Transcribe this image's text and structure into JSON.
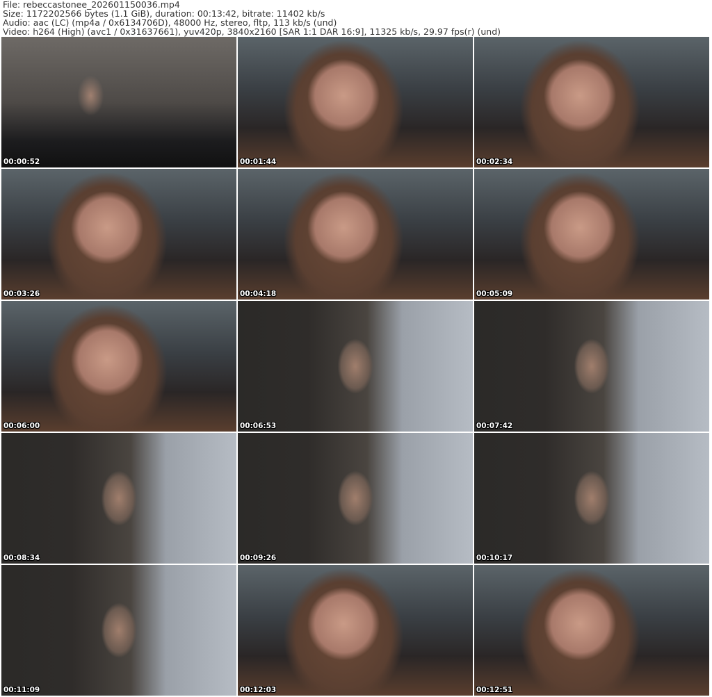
{
  "header": {
    "file": "File: rebeccastonee_202601150036.mp4",
    "size": "Size: 1172202566 bytes (1.1 GiB), duration: 00:13:42, bitrate: 11402 kb/s",
    "audio": "Audio: aac (LC) (mp4a / 0x6134706D), 48000 Hz, stereo, fltp, 113 kb/s (und)",
    "video": "Video: h264 (High) (avc1 / 0x31637661), yuv420p, 3840x2160 [SAR 1:1 DAR 16:9], 11325 kb/s, 29.97 fps(r) (und)"
  },
  "thumbnails": [
    {
      "time": "00:00:52",
      "scene": "first"
    },
    {
      "time": "00:01:44",
      "scene": "close"
    },
    {
      "time": "00:02:34",
      "scene": "close"
    },
    {
      "time": "00:03:26",
      "scene": "close"
    },
    {
      "time": "00:04:18",
      "scene": "close"
    },
    {
      "time": "00:05:09",
      "scene": "close"
    },
    {
      "time": "00:06:00",
      "scene": "close"
    },
    {
      "time": "00:06:53",
      "scene": "wide"
    },
    {
      "time": "00:07:42",
      "scene": "wide"
    },
    {
      "time": "00:08:34",
      "scene": "wide"
    },
    {
      "time": "00:09:26",
      "scene": "wide"
    },
    {
      "time": "00:10:17",
      "scene": "wide"
    },
    {
      "time": "00:11:09",
      "scene": "wide"
    },
    {
      "time": "00:12:03",
      "scene": "close"
    },
    {
      "time": "00:12:51",
      "scene": "close"
    }
  ]
}
